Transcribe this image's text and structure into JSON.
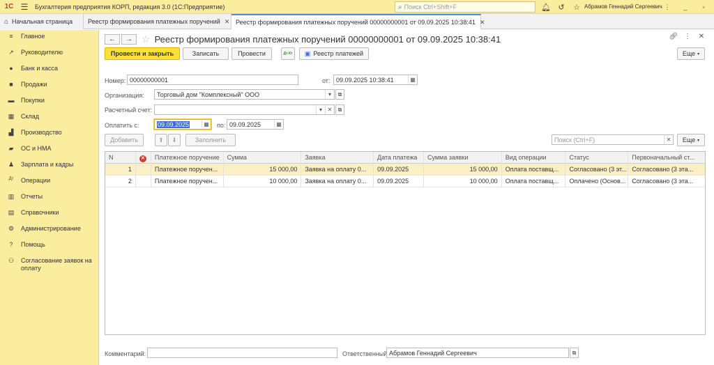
{
  "app": {
    "logo": "1С",
    "title": "Бухгалтерия предприятия КОРП, редакция 3.0  (1С:Предприятие)",
    "search_placeholder": "Поиск Ctrl+Shift+F",
    "user": "Абрамов Геннадий Сергеевич"
  },
  "tabs": [
    {
      "label": "Начальная страница",
      "icon": "home-icon"
    },
    {
      "label": "Реестр формирования платежных поручений"
    },
    {
      "label": "Реестр формирования платежных поручений  00000000001 от 09.09.2025 10:38:41"
    }
  ],
  "sidebar": {
    "items": [
      {
        "label": "Главное",
        "icon": "menu-icon"
      },
      {
        "label": "Руководителю",
        "icon": "trend-icon"
      },
      {
        "label": "Банк и касса",
        "icon": "coin-icon"
      },
      {
        "label": "Продажи",
        "icon": "bag-icon"
      },
      {
        "label": "Покупки",
        "icon": "cart-icon"
      },
      {
        "label": "Склад",
        "icon": "warehouse-icon"
      },
      {
        "label": "Производство",
        "icon": "factory-icon"
      },
      {
        "label": "ОС и НМА",
        "icon": "truck-icon"
      },
      {
        "label": "Зарплата и кадры",
        "icon": "people-icon"
      },
      {
        "label": "Операции",
        "icon": "dt-kt-icon"
      },
      {
        "label": "Отчеты",
        "icon": "chart-icon"
      },
      {
        "label": "Справочники",
        "icon": "book-icon"
      },
      {
        "label": "Администрирование",
        "icon": "gear-icon"
      },
      {
        "label": "Помощь",
        "icon": "help-icon"
      },
      {
        "label": "Согласование заявок на оплату",
        "icon": "approve-icon"
      }
    ]
  },
  "doc": {
    "title": "Реестр формирования платежных поручений  00000000001 от 09.09.2025 10:38:41"
  },
  "toolbar": {
    "post_close": "Провести и закрыть",
    "save": "Записать",
    "post": "Провести",
    "dtkt": "Дт Кт",
    "registry": "Реестр платежей",
    "more": "Еще"
  },
  "form": {
    "number_label": "Номер:",
    "number": "00000000001",
    "date_label": "от:",
    "date": "09.09.2025 10:38:41",
    "org_label": "Организация:",
    "org": "Торговый дом \"Комплексный\" ООО",
    "account_label": "Расчетный счет:",
    "account": "",
    "pay_from_label": "Оплатить с:",
    "pay_from": "09.09.2025",
    "pay_to_label": "по:",
    "pay_to": "09.09.2025",
    "comment_label": "Комментарий:",
    "comment": "",
    "responsible_label": "Ответственный:",
    "responsible": "Абрамов Геннадий Сергеевич"
  },
  "table_toolbar": {
    "add": "Добавить",
    "fill": "Заполнить",
    "search_placeholder": "Поиск (Ctrl+F)",
    "more": "Еще"
  },
  "table": {
    "columns": [
      "N",
      "",
      "Платежное поручение",
      "Сумма",
      "Заявка",
      "Дата платежа",
      "Сумма заявки",
      "Вид операции",
      "Статус",
      "Первоначальный ст..."
    ],
    "rows": [
      {
        "n": "1",
        "pp": "Платежное поручен...",
        "sum": "15 000,00",
        "req": "Заявка на оплату  0...",
        "date": "09.09.2025",
        "req_sum": "15 000,00",
        "op": "Оплата поставщ...",
        "status": "Согласовано (3 эт...",
        "init": "Согласовано (3 эта..."
      },
      {
        "n": "2",
        "pp": "Платежное поручен...",
        "sum": "10 000,00",
        "req": "Заявка на оплату  0...",
        "date": "09.09.2025",
        "req_sum": "10 000,00",
        "op": "Оплата поставщ...",
        "status": "Оплачено (Основ...",
        "init": "Согласовано (3 эта..."
      }
    ]
  },
  "colors": {
    "accent_yellow": "#fbed9e",
    "primary_button": "#fce13d",
    "selected_row": "#fbf0c4",
    "selection_blue": "#3b6fd4"
  }
}
